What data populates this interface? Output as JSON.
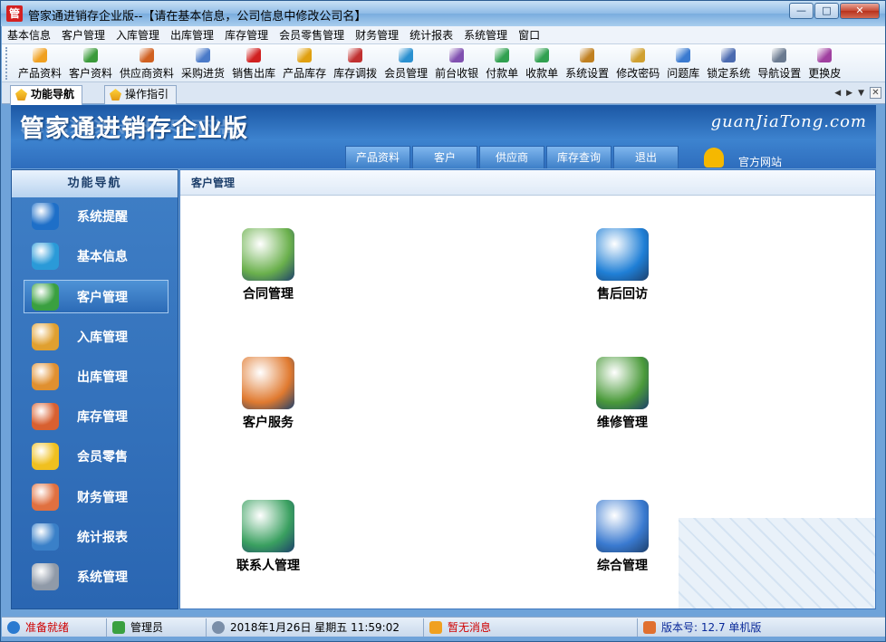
{
  "window": {
    "app_icon_text": "管",
    "title": "管家通进销存企业版--【请在基本信息，公司信息中修改公司名】",
    "min": "—",
    "max": "□",
    "close": "✕"
  },
  "menu": [
    "基本信息",
    "客户管理",
    "入库管理",
    "出库管理",
    "库存管理",
    "会员零售管理",
    "财务管理",
    "统计报表",
    "系统管理",
    "窗口"
  ],
  "toolbar": [
    {
      "label": "产品资料",
      "icon": "product-icon",
      "color": "#f0a020"
    },
    {
      "label": "客户资料",
      "icon": "customer-icon",
      "color": "#3a9a3a"
    },
    {
      "label": "供应商资料",
      "icon": "supplier-icon",
      "color": "#d06020"
    },
    {
      "label": "采购进货",
      "icon": "purchase-icon",
      "color": "#4a7ac8"
    },
    {
      "label": "销售出库",
      "icon": "sales-icon",
      "color": "#d02020"
    },
    {
      "label": "产品库存",
      "icon": "stock-icon",
      "color": "#e0a010"
    },
    {
      "label": "库存调拨",
      "icon": "transfer-icon",
      "color": "#c03030"
    },
    {
      "label": "会员管理",
      "icon": "member-icon",
      "color": "#2a90d0"
    },
    {
      "label": "前台收银",
      "icon": "cashier-icon",
      "color": "#8050b0"
    },
    {
      "label": "付款单",
      "icon": "payment-icon",
      "color": "#30a050"
    },
    {
      "label": "收款单",
      "icon": "receipt-icon",
      "color": "#30a050"
    },
    {
      "label": "系统设置",
      "icon": "settings-icon",
      "color": "#c08020"
    },
    {
      "label": "修改密码",
      "icon": "password-icon",
      "color": "#d0a030"
    },
    {
      "label": "问题库",
      "icon": "faq-icon",
      "color": "#3a7ad0"
    },
    {
      "label": "锁定系统",
      "icon": "lock-icon",
      "color": "#4a6ab0"
    },
    {
      "label": "导航设置",
      "icon": "nav-settings-icon",
      "color": "#6a7a90"
    },
    {
      "label": "更换皮",
      "icon": "skin-icon",
      "color": "#a040a0"
    }
  ],
  "tabs": [
    {
      "label": "功能导航"
    },
    {
      "label": "操作指引"
    }
  ],
  "tab_nav": {
    "left": "◀",
    "right": "▶",
    "down": "▼",
    "close": "✕"
  },
  "banner": {
    "title": "管家通进销存企业版",
    "url": "guanJiaTong.com",
    "tabs": [
      "产品资料",
      "客户",
      "供应商",
      "库存查询",
      "退出"
    ],
    "official": "官方网站"
  },
  "sidebar": {
    "heading": "功能导航",
    "items": [
      {
        "label": "系统提醒",
        "icon": "info-icon",
        "color": "#1e6fc8"
      },
      {
        "label": "基本信息",
        "icon": "cubes-icon",
        "color": "#2a9ad8"
      },
      {
        "label": "客户管理",
        "icon": "users-icon",
        "color": "#3aa040"
      },
      {
        "label": "入库管理",
        "icon": "box-in-icon",
        "color": "#e0a030"
      },
      {
        "label": "出库管理",
        "icon": "box-out-icon",
        "color": "#e09030"
      },
      {
        "label": "库存管理",
        "icon": "warehouse-icon",
        "color": "#d86030"
      },
      {
        "label": "会员零售",
        "icon": "member-cloud-icon",
        "color": "#f0c020"
      },
      {
        "label": "财务管理",
        "icon": "finance-icon",
        "color": "#e07040"
      },
      {
        "label": "统计报表",
        "icon": "chart-icon",
        "color": "#3a80c8"
      },
      {
        "label": "系统管理",
        "icon": "gears-icon",
        "color": "#909aa8"
      }
    ]
  },
  "main": {
    "heading": "客户管理",
    "functions": [
      {
        "label": "合同管理",
        "icon": "contract-icon",
        "color": "#6ab04c"
      },
      {
        "label": "售后回访",
        "icon": "alert-bubble-icon",
        "color": "#1f7fd6"
      },
      {
        "label": "客户服务",
        "icon": "customer-service-icon",
        "color": "#e07a30"
      },
      {
        "label": "维修管理",
        "icon": "tools-icon",
        "color": "#4a9a3a"
      },
      {
        "label": "联系人管理",
        "icon": "contact-card-icon",
        "color": "#3aa060"
      },
      {
        "label": "综合管理",
        "icon": "folder-icon",
        "color": "#3a7ad0"
      }
    ]
  },
  "status": {
    "ready": "准备就绪",
    "user": "管理员",
    "datetime": "2018年1月26日   星期五      11:59:02",
    "message": "暂无消息",
    "version": "版本号: 12.7 单机版"
  }
}
